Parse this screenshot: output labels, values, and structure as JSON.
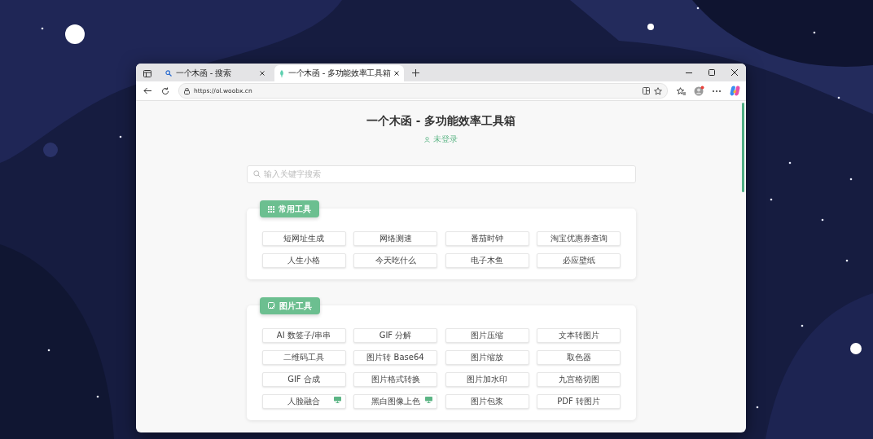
{
  "browser": {
    "tabs": [
      {
        "title": "一个木函 - 搜索",
        "selected": false
      },
      {
        "title": "一个木函 - 多功能效率工具箱",
        "selected": true
      }
    ],
    "url": "https://ol.woobx.cn"
  },
  "page": {
    "title": "一个木函 - 多功能效率工具箱",
    "login_status": "未登录",
    "search": {
      "placeholder": "输入关键字搜索"
    },
    "sections": [
      {
        "title": "常用工具",
        "tools": [
          {
            "label": "短网址生成",
            "desktop": false
          },
          {
            "label": "网络测速",
            "desktop": false
          },
          {
            "label": "番茄时钟",
            "desktop": false
          },
          {
            "label": "淘宝优惠券查询",
            "desktop": false
          },
          {
            "label": "人生小格",
            "desktop": false
          },
          {
            "label": "今天吃什么",
            "desktop": false
          },
          {
            "label": "电子木鱼",
            "desktop": false
          },
          {
            "label": "必应壁纸",
            "desktop": false
          }
        ]
      },
      {
        "title": "图片工具",
        "tools": [
          {
            "label": "AI 数签子/串串",
            "desktop": false
          },
          {
            "label": "GIF 分解",
            "desktop": false
          },
          {
            "label": "图片压缩",
            "desktop": false
          },
          {
            "label": "文本转图片",
            "desktop": false
          },
          {
            "label": "二维码工具",
            "desktop": false
          },
          {
            "label": "图片转 Base64",
            "desktop": false
          },
          {
            "label": "图片缩放",
            "desktop": false
          },
          {
            "label": "取色器",
            "desktop": false
          },
          {
            "label": "GIF 合成",
            "desktop": false
          },
          {
            "label": "图片格式转换",
            "desktop": false
          },
          {
            "label": "图片加水印",
            "desktop": false
          },
          {
            "label": "九宫格切图",
            "desktop": false
          },
          {
            "label": "人脸融合",
            "desktop": true
          },
          {
            "label": "黑白图像上色",
            "desktop": true
          },
          {
            "label": "图片包浆",
            "desktop": false
          },
          {
            "label": "PDF 转图片",
            "desktop": false
          }
        ]
      }
    ]
  }
}
